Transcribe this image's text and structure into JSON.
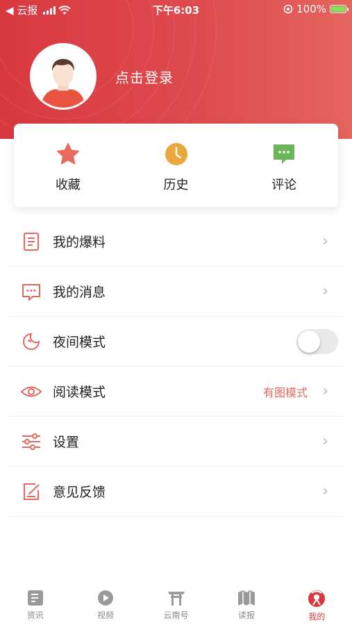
{
  "status_bar": {
    "back_app": "◀ 云报",
    "time": "下午6:03",
    "battery": "100%"
  },
  "profile": {
    "login_text": "点击登录"
  },
  "quick_actions": [
    {
      "label": "收藏",
      "icon": "star-icon"
    },
    {
      "label": "历史",
      "icon": "clock-icon"
    },
    {
      "label": "评论",
      "icon": "comment-icon"
    }
  ],
  "menu": [
    {
      "label": "我的爆料",
      "icon": "document-icon"
    },
    {
      "label": "我的消息",
      "icon": "message-icon"
    },
    {
      "label": "夜间模式",
      "icon": "moon-icon",
      "toggle_on": false
    },
    {
      "label": "阅读模式",
      "icon": "eye-icon",
      "value": "有图模式"
    },
    {
      "label": "设置",
      "icon": "sliders-icon"
    },
    {
      "label": "意见反馈",
      "icon": "feedback-icon"
    }
  ],
  "tabbar": [
    {
      "label": "资讯",
      "icon": "news-icon"
    },
    {
      "label": "视频",
      "icon": "video-icon"
    },
    {
      "label": "云南号",
      "icon": "gate-icon"
    },
    {
      "label": "读报",
      "icon": "newspaper-icon"
    },
    {
      "label": "我的",
      "icon": "profile-icon",
      "active": true
    }
  ],
  "colors": {
    "brand_red": "#d8393f",
    "accent_orange": "#e2685d",
    "star": "#e96a61",
    "clock": "#e9a73c",
    "comment": "#6bb65a"
  }
}
